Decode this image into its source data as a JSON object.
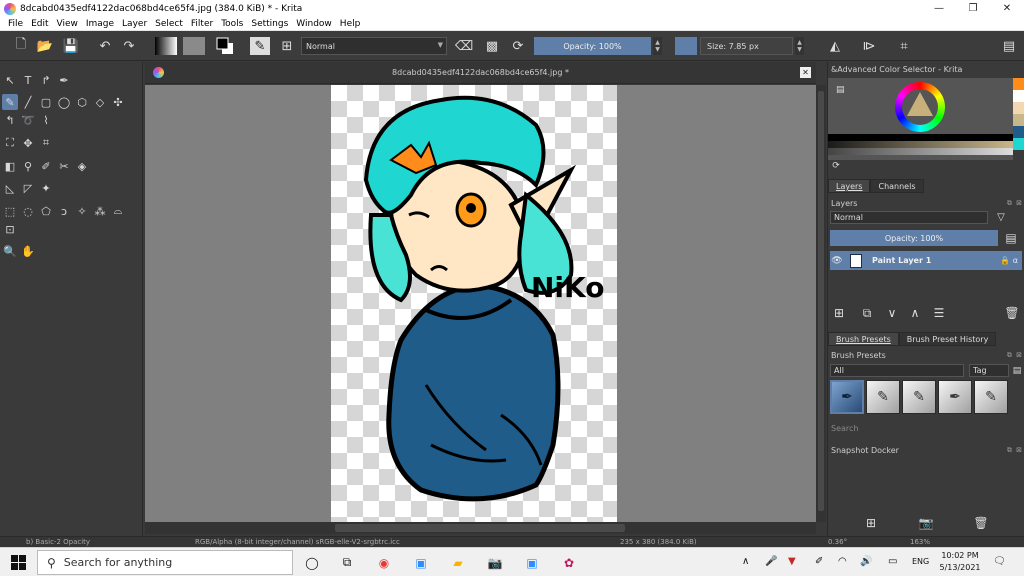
{
  "window": {
    "title": "8dcabd0435edf4122dac068bd4ce65f4.jpg (384.0 KiB)  * - Krita",
    "minimize": "—",
    "maximize": "❐",
    "close": "✕"
  },
  "menu": [
    "File",
    "Edit",
    "View",
    "Image",
    "Layer",
    "Select",
    "Filter",
    "Tools",
    "Settings",
    "Window",
    "Help"
  ],
  "toolbar": {
    "blend_mode": "Normal",
    "opacity": "Opacity: 100%",
    "size": "Size: 7.85 px"
  },
  "document": {
    "tab_title": "8dcabd0435edf4122dac068bd4ce65f4.jpg *",
    "artwork_text": "NiKo"
  },
  "dockers": {
    "color_selector_title": "&Advanced Color Selector - Krita",
    "tabs": [
      "Layers",
      "Channels"
    ],
    "layers_title": "Layers",
    "blend_mode": "Normal",
    "opacity": "Opacity:  100%",
    "layer_name": "Paint Layer 1",
    "brush_tabs": [
      "Brush Presets",
      "Brush Preset History"
    ],
    "brush_presets_title": "Brush Presets",
    "filter_all": "All",
    "tag_label": "Tag",
    "search_placeholder": "Search",
    "snapshot_title": "Snapshot Docker"
  },
  "statusbar": {
    "brush": "b) Basic-2 Opacity",
    "color_profile": "RGB/Alpha (8-bit integer/channel)  sRGB-elle-V2-srgbtrc.icc",
    "dimensions": "235 x 380 (384.0 KiB)",
    "rotation": "0.36°",
    "zoom": "163%"
  },
  "taskbar": {
    "search_placeholder": "Search for anything",
    "language": "ENG",
    "time": "10:02 PM",
    "date": "5/13/2021"
  },
  "colors": {
    "accent": "#5f7fa8",
    "hair": "#1fd6d0",
    "hoodie": "#1f5c8a",
    "skin": "#ffe6c4"
  }
}
